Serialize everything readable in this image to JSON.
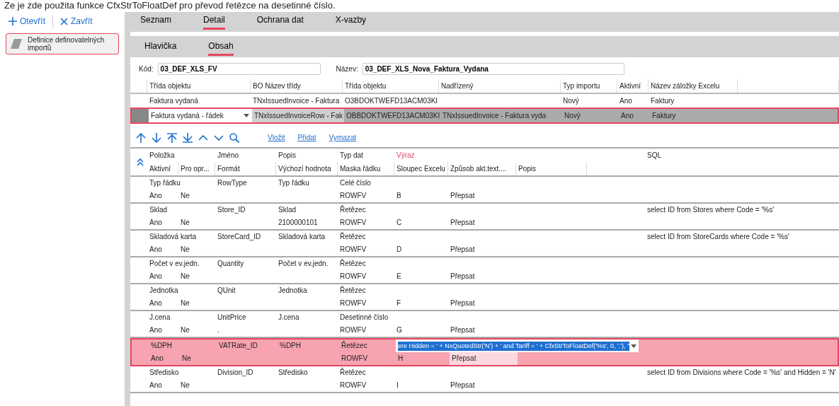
{
  "caption": "Ze je zde použita funkce CfxStrToFloatDef pro převod řetězce na desetinné číslo.",
  "sidebar": {
    "actions": [
      {
        "kind": "open",
        "label": "Otevřít"
      },
      {
        "kind": "close",
        "label": "Zavřít"
      }
    ],
    "items": [
      {
        "label": "Definice definovatelných importů",
        "selected": true
      }
    ]
  },
  "tabs": [
    {
      "label": "Seznam",
      "selected": false
    },
    {
      "label": "Detail",
      "selected": true
    },
    {
      "label": "Ochrana dat",
      "selected": false
    },
    {
      "label": "X-vazby",
      "selected": false
    }
  ],
  "subtabs": [
    {
      "label": "Hlavička",
      "selected": false
    },
    {
      "label": "Obsah",
      "selected": true
    }
  ],
  "form": {
    "fields": [
      {
        "label": "Kód:",
        "value": "03_DEF_XLS_FV"
      },
      {
        "label": "Název:",
        "value": "03_DEF_XLS_Nova_Faktura_Vydana"
      }
    ]
  },
  "master": {
    "columns": [
      "Třída objektu",
      "BO Název třídy",
      "Třída objektu",
      "Nadřízený",
      "Typ importu",
      "Aktivní",
      "Název záložky Excelu"
    ],
    "rows": [
      {
        "selected": false,
        "trida_objektu": "Faktura vydaná",
        "bo_nazev_tridy": "TNxIssuedInvoice - Faktura",
        "trida_objektu_2": "O3BDOKTWEFD13ACM03KI",
        "typ_importu": "Nový",
        "aktivni": "Ano",
        "nazev_zalozky": "Faktury"
      },
      {
        "selected": true,
        "trida_objektu": "Faktura vydaná - řádek",
        "bo_nazev_tridy": "TNxIssuedInvoiceRow - Fak",
        "trida_objektu_2": "OBBDOKTWEFD13ACM03KI",
        "nadrizeny": "TNxIssuedInvoice - Faktura vyda",
        "typ_importu": "Nový",
        "aktivni": "Ano",
        "nazev_zalozky": "Faktury"
      }
    ]
  },
  "toolbar": {
    "links": [
      "Vložit",
      "Přidat",
      "Vymazat"
    ]
  },
  "detail": {
    "header_1": [
      {
        "label": "Položka",
        "highlighted": false
      },
      {
        "label": "Jméno",
        "highlighted": false
      },
      {
        "label": "Popis",
        "highlighted": false
      },
      {
        "label": "Typ dat",
        "highlighted": false
      },
      {
        "label": "Výraz",
        "highlighted": true
      },
      {
        "label": "SQL",
        "highlighted": false
      }
    ],
    "header_2": [
      "Aktivní",
      "Pro opr...",
      "Formát",
      "Výchozí hodnota",
      "Maska řádku",
      "Sloupec Excelu",
      "Způsob akt.text....",
      "Popis"
    ],
    "rows": [
      {
        "selected": false,
        "polozka": "Typ řádku",
        "jmeno": "RowType",
        "popis": "Typ řádku",
        "typ_dat": "Celé číslo",
        "aktivni": "Ano",
        "pro_opravu": "Ne",
        "maska_radku": "ROWFV",
        "sloupec_excelu": "B",
        "zpusob": "Přepsat"
      },
      {
        "selected": false,
        "polozka": "Sklad",
        "jmeno": "Store_ID",
        "popis": "Sklad",
        "typ_dat": "Řetězec",
        "sql": "select ID from Stores where Code = '%s'",
        "aktivni": "Ano",
        "pro_opravu": "Ne",
        "vychozi_hodnota": "2100000101",
        "maska_radku": "ROWFV",
        "sloupec_excelu": "C",
        "zpusob": "Přepsat"
      },
      {
        "selected": false,
        "polozka": "Skladová karta",
        "jmeno": "StoreCard_ID",
        "popis": "Skladová karta",
        "typ_dat": "Řetězec",
        "sql": "select ID from StoreCards where Code = '%s'",
        "aktivni": "Ano",
        "pro_opravu": "Ne",
        "maska_radku": "ROWFV",
        "sloupec_excelu": "D",
        "zpusob": "Přepsat"
      },
      {
        "selected": false,
        "polozka": "Počet v ev.jedn.",
        "jmeno": "Quantity",
        "popis": "Počet v ev.jedn.",
        "typ_dat": "Řetězec",
        "aktivni": "Ano",
        "pro_opravu": "Ne",
        "maska_radku": "ROWFV",
        "sloupec_excelu": "E",
        "zpusob": "Přepsat"
      },
      {
        "selected": false,
        "polozka": "Jednotka",
        "jmeno": "QUnit",
        "popis": "Jednotka",
        "typ_dat": "Řetězec",
        "aktivni": "Ano",
        "pro_opravu": "Ne",
        "maska_radku": "ROWFV",
        "sloupec_excelu": "F",
        "zpusob": "Přepsat"
      },
      {
        "selected": false,
        "polozka": "J.cena",
        "jmeno": "UnitPrice",
        "popis": "J.cena",
        "typ_dat": "Desetinné číslo",
        "aktivni": "Ano",
        "pro_opravu": "Ne",
        "format": ".",
        "maska_radku": "ROWFV",
        "sloupec_excelu": "G",
        "zpusob": "Přepsat"
      },
      {
        "selected": true,
        "polozka": "%DPH",
        "jmeno": "VATRate_ID",
        "popis": "%DPH",
        "typ_dat": "Řetězec",
        "vyraz": "ere Hidden = ' + NxQuotedStr('N') + ' and Tariff = ' + CfxStrToFloatDef('%s', 0, '.'), ''",
        "aktivni": "Ano",
        "pro_opravu": "Ne",
        "maska_radku": "ROWFV",
        "sloupec_excelu": "H",
        "zpusob": "Přepsat"
      },
      {
        "selected": false,
        "polozka": "Středisko",
        "jmeno": "Division_ID",
        "popis": "Středisko",
        "typ_dat": "Řetězec",
        "sql": "select ID from Divisions where Code = '%s' and Hidden = 'N'",
        "aktivni": "Ano",
        "pro_opravu": "Ne",
        "maska_radku": "ROWFV",
        "sloupec_excelu": "I",
        "zpusob": "Přepsat"
      }
    ]
  }
}
